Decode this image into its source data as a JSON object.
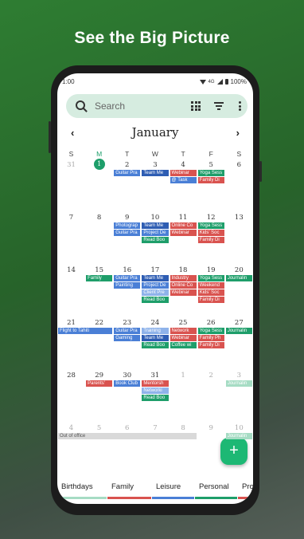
{
  "headline": "See the Big Picture",
  "status": {
    "time": "1:00",
    "network": "4G",
    "battery": "100%"
  },
  "search": {
    "placeholder": "Search"
  },
  "calendar": {
    "month": "January",
    "weekdays": [
      "S",
      "M",
      "T",
      "W",
      "T",
      "F",
      "S"
    ],
    "today_index": 1,
    "weeks": [
      {
        "days": [
          "31",
          "1",
          "2",
          "3",
          "4",
          "5",
          "6"
        ],
        "out": [
          0
        ],
        "events": [
          {
            "col": 2,
            "row": 0,
            "label": "Guitar Pra",
            "color": "#4a7fd6"
          },
          {
            "col": 3,
            "row": 0,
            "label": "Team Me",
            "color": "#2e5db3"
          },
          {
            "col": 4,
            "row": 0,
            "label": "Webinar",
            "color": "#d9534f"
          },
          {
            "col": 4,
            "row": 1,
            "label": "@ Task",
            "color": "#4a7fd6"
          },
          {
            "col": 5,
            "row": 0,
            "label": "Yoga Sess",
            "color": "#1e9e6a"
          },
          {
            "col": 5,
            "row": 1,
            "label": "Family Di",
            "color": "#d9534f"
          }
        ]
      },
      {
        "days": [
          "7",
          "8",
          "9",
          "10",
          "11",
          "12",
          "13"
        ],
        "out": [],
        "events": [
          {
            "col": 2,
            "row": 0,
            "label": "Photograp",
            "color": "#4a7fd6"
          },
          {
            "col": 2,
            "row": 1,
            "label": "Guitar Pra",
            "color": "#4a7fd6"
          },
          {
            "col": 3,
            "row": 0,
            "label": "Team Me",
            "color": "#2e5db3"
          },
          {
            "col": 3,
            "row": 1,
            "label": "Project De",
            "color": "#4a7fd6"
          },
          {
            "col": 3,
            "row": 2,
            "label": "Read Boo",
            "color": "#1e9e6a"
          },
          {
            "col": 4,
            "row": 0,
            "label": "Online Co",
            "color": "#d9534f"
          },
          {
            "col": 4,
            "row": 1,
            "label": "Webinar",
            "color": "#d9534f"
          },
          {
            "col": 5,
            "row": 0,
            "label": "Yoga Sess",
            "color": "#1e9e6a"
          },
          {
            "col": 5,
            "row": 1,
            "label": "Kids' Soc",
            "color": "#d9534f"
          },
          {
            "col": 5,
            "row": 2,
            "label": "Family Di",
            "color": "#d9534f"
          }
        ]
      },
      {
        "days": [
          "14",
          "15",
          "16",
          "17",
          "18",
          "19",
          "20"
        ],
        "out": [],
        "events": [
          {
            "col": 1,
            "row": 0,
            "label": "Family",
            "color": "#1e9e6a"
          },
          {
            "col": 2,
            "row": 0,
            "label": "Guitar Pra",
            "color": "#4a7fd6"
          },
          {
            "col": 2,
            "row": 1,
            "label": "Painting",
            "color": "#4a7fd6"
          },
          {
            "col": 3,
            "row": 0,
            "label": "Team Me",
            "color": "#2e5db3"
          },
          {
            "col": 3,
            "row": 1,
            "label": "Project De",
            "color": "#4a7fd6"
          },
          {
            "col": 3,
            "row": 2,
            "label": "Client Pre",
            "color": "#8fb3ea"
          },
          {
            "col": 3,
            "row": 3,
            "label": "Read Boo",
            "color": "#1e9e6a"
          },
          {
            "col": 4,
            "row": 0,
            "label": "Industry",
            "color": "#d9534f"
          },
          {
            "col": 4,
            "row": 1,
            "label": "Online Co",
            "color": "#d9534f"
          },
          {
            "col": 4,
            "row": 2,
            "label": "Webinar",
            "color": "#d9534f"
          },
          {
            "col": 5,
            "row": 0,
            "label": "Yoga Sess",
            "color": "#1e9e6a"
          },
          {
            "col": 5,
            "row": 1,
            "label": "Weekend",
            "color": "#d9534f"
          },
          {
            "col": 5,
            "row": 2,
            "label": "Kids' Soc",
            "color": "#d9534f"
          },
          {
            "col": 5,
            "row": 3,
            "label": "Family Di",
            "color": "#d9534f"
          },
          {
            "col": 6,
            "row": 0,
            "label": "Journalin",
            "color": "#1e9e6a"
          }
        ]
      },
      {
        "days": [
          "21",
          "22",
          "23",
          "24",
          "25",
          "26",
          "27"
        ],
        "out": [],
        "events": [
          {
            "col": 0,
            "row": 0,
            "label": "Flight to Tahiti",
            "color": "#4a7fd6",
            "span": 2
          },
          {
            "col": 2,
            "row": 0,
            "label": "Guitar Pra",
            "color": "#4a7fd6"
          },
          {
            "col": 2,
            "row": 1,
            "label": "Gaming",
            "color": "#4a7fd6"
          },
          {
            "col": 3,
            "row": 0,
            "label": "Training",
            "color": "#8fb3ea"
          },
          {
            "col": 3,
            "row": 1,
            "label": "Team Me",
            "color": "#2e5db3"
          },
          {
            "col": 3,
            "row": 2,
            "label": "Read Boo",
            "color": "#1e9e6a"
          },
          {
            "col": 4,
            "row": 0,
            "label": "Network",
            "color": "#d9534f"
          },
          {
            "col": 4,
            "row": 1,
            "label": "Webinar",
            "color": "#d9534f"
          },
          {
            "col": 4,
            "row": 2,
            "label": "Coffee wi",
            "color": "#1e9e6a"
          },
          {
            "col": 5,
            "row": 0,
            "label": "Yoga Sess",
            "color": "#1e9e6a"
          },
          {
            "col": 5,
            "row": 1,
            "label": "Family Ph",
            "color": "#d9534f"
          },
          {
            "col": 5,
            "row": 2,
            "label": "Family Di",
            "color": "#d9534f"
          },
          {
            "col": 6,
            "row": 0,
            "label": "Journalin",
            "color": "#1e9e6a"
          }
        ]
      },
      {
        "days": [
          "28",
          "29",
          "30",
          "31",
          "1",
          "2",
          "3"
        ],
        "out": [
          4,
          5,
          6
        ],
        "events": [
          {
            "col": 1,
            "row": 0,
            "label": "Parents'",
            "color": "#d9534f"
          },
          {
            "col": 2,
            "row": 0,
            "label": "Book Club",
            "color": "#4a7fd6"
          },
          {
            "col": 3,
            "row": 0,
            "label": "Mentorsh",
            "color": "#d9534f"
          },
          {
            "col": 3,
            "row": 1,
            "label": "Networki",
            "color": "#8fb3ea"
          },
          {
            "col": 3,
            "row": 2,
            "label": "Read Boo",
            "color": "#1e9e6a"
          },
          {
            "col": 6,
            "row": 0,
            "label": "Journalin",
            "color": "#a6dcc4"
          }
        ]
      },
      {
        "days": [
          "4",
          "5",
          "6",
          "7",
          "8",
          "9",
          "10"
        ],
        "out": [
          0,
          1,
          2,
          3,
          4,
          5,
          6
        ],
        "events": [
          {
            "col": 0,
            "row": 0,
            "label": "Out of office",
            "color": "#d9d9d9",
            "span": 5,
            "dark": true
          },
          {
            "col": 6,
            "row": 0,
            "label": "Journalin",
            "color": "#a6dcc4"
          }
        ]
      }
    ]
  },
  "fab": {
    "label": "+"
  },
  "categories": [
    {
      "label": "Birthdays",
      "color": "#a6dcc4"
    },
    {
      "label": "Family",
      "color": "#d9534f"
    },
    {
      "label": "Leisure",
      "color": "#4a7fd6"
    },
    {
      "label": "Personal",
      "color": "#1e9e6a"
    },
    {
      "label": "Profe",
      "color": "#d9534f"
    }
  ]
}
